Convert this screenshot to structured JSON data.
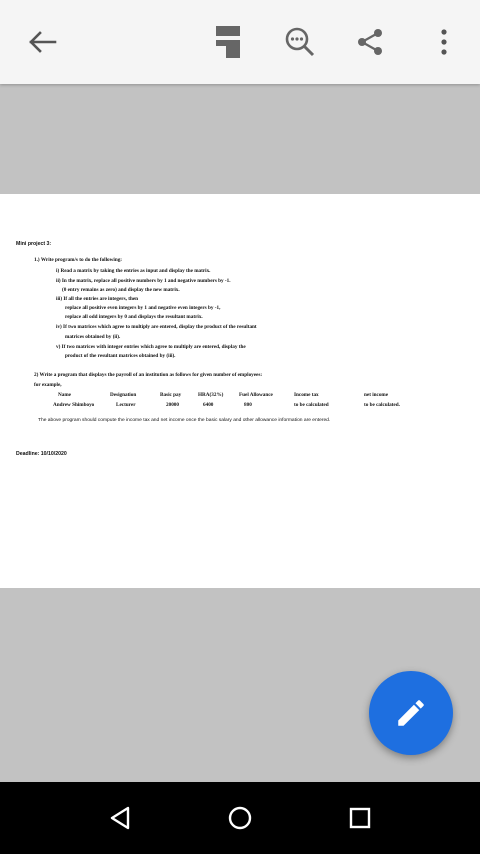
{
  "toolbar": {
    "icons": [
      "back-arrow-icon",
      "document-layout-icon",
      "search-icon",
      "share-icon",
      "more-vert-icon"
    ]
  },
  "document": {
    "title": "Mini project 3:",
    "q1": {
      "intro": "1.) Write program/s to do the following:",
      "i": "i) Read a matrix by taking the entries as input and display the matrix.",
      "ii_a": "ii) In the matrix, replace all positive numbers by 1 and negative numbers by -1.",
      "ii_b": "(0 entry remains as zero) and display the new matrix.",
      "iii_a": "iii) If all the entries are integers, then",
      "iii_b": "replace all positive even integers by 1 and negative even integers by -1,",
      "iii_c": "replace all odd integers by 0 and displays the resultant matrix.",
      "iv_a": "iv) If two matrices which agree to multiply are entered, display the product of the resultant",
      "iv_b": "matrices obtained by (ii).",
      "v_a": "v)  If two matrices with integer entries which agree to multiply are entered, display the",
      "v_b": "product of the resultant matrices obtained by (iii)."
    },
    "q2": {
      "intro": "2) Write a program that displays the payroll of an institution as follows for given number of employees:",
      "example": "for example,"
    },
    "table": {
      "headers": [
        "Name",
        "Designation",
        "Basic pay",
        "HRA(32%)",
        "Fuel Allowance",
        "Income tax",
        "net income"
      ],
      "row": [
        "Andrew Shimboyo",
        "Lecturer",
        "20000",
        "6400",
        "800",
        "to be calculated",
        "to be calculated."
      ]
    },
    "note": "The above program should compute the income tax and net income once the basic salary and other allowance information are entered.",
    "deadline": "Deadline: 10/10/2020"
  },
  "fab": {
    "icon": "edit-pencil-icon"
  },
  "navbar": {
    "icons": [
      "nav-back-icon",
      "nav-home-icon",
      "nav-recents-icon"
    ]
  },
  "colors": {
    "toolbar": "#f5f5f5",
    "background": "#c2c2c2",
    "fab": "#1e6fe0",
    "navbar": "#000000"
  }
}
